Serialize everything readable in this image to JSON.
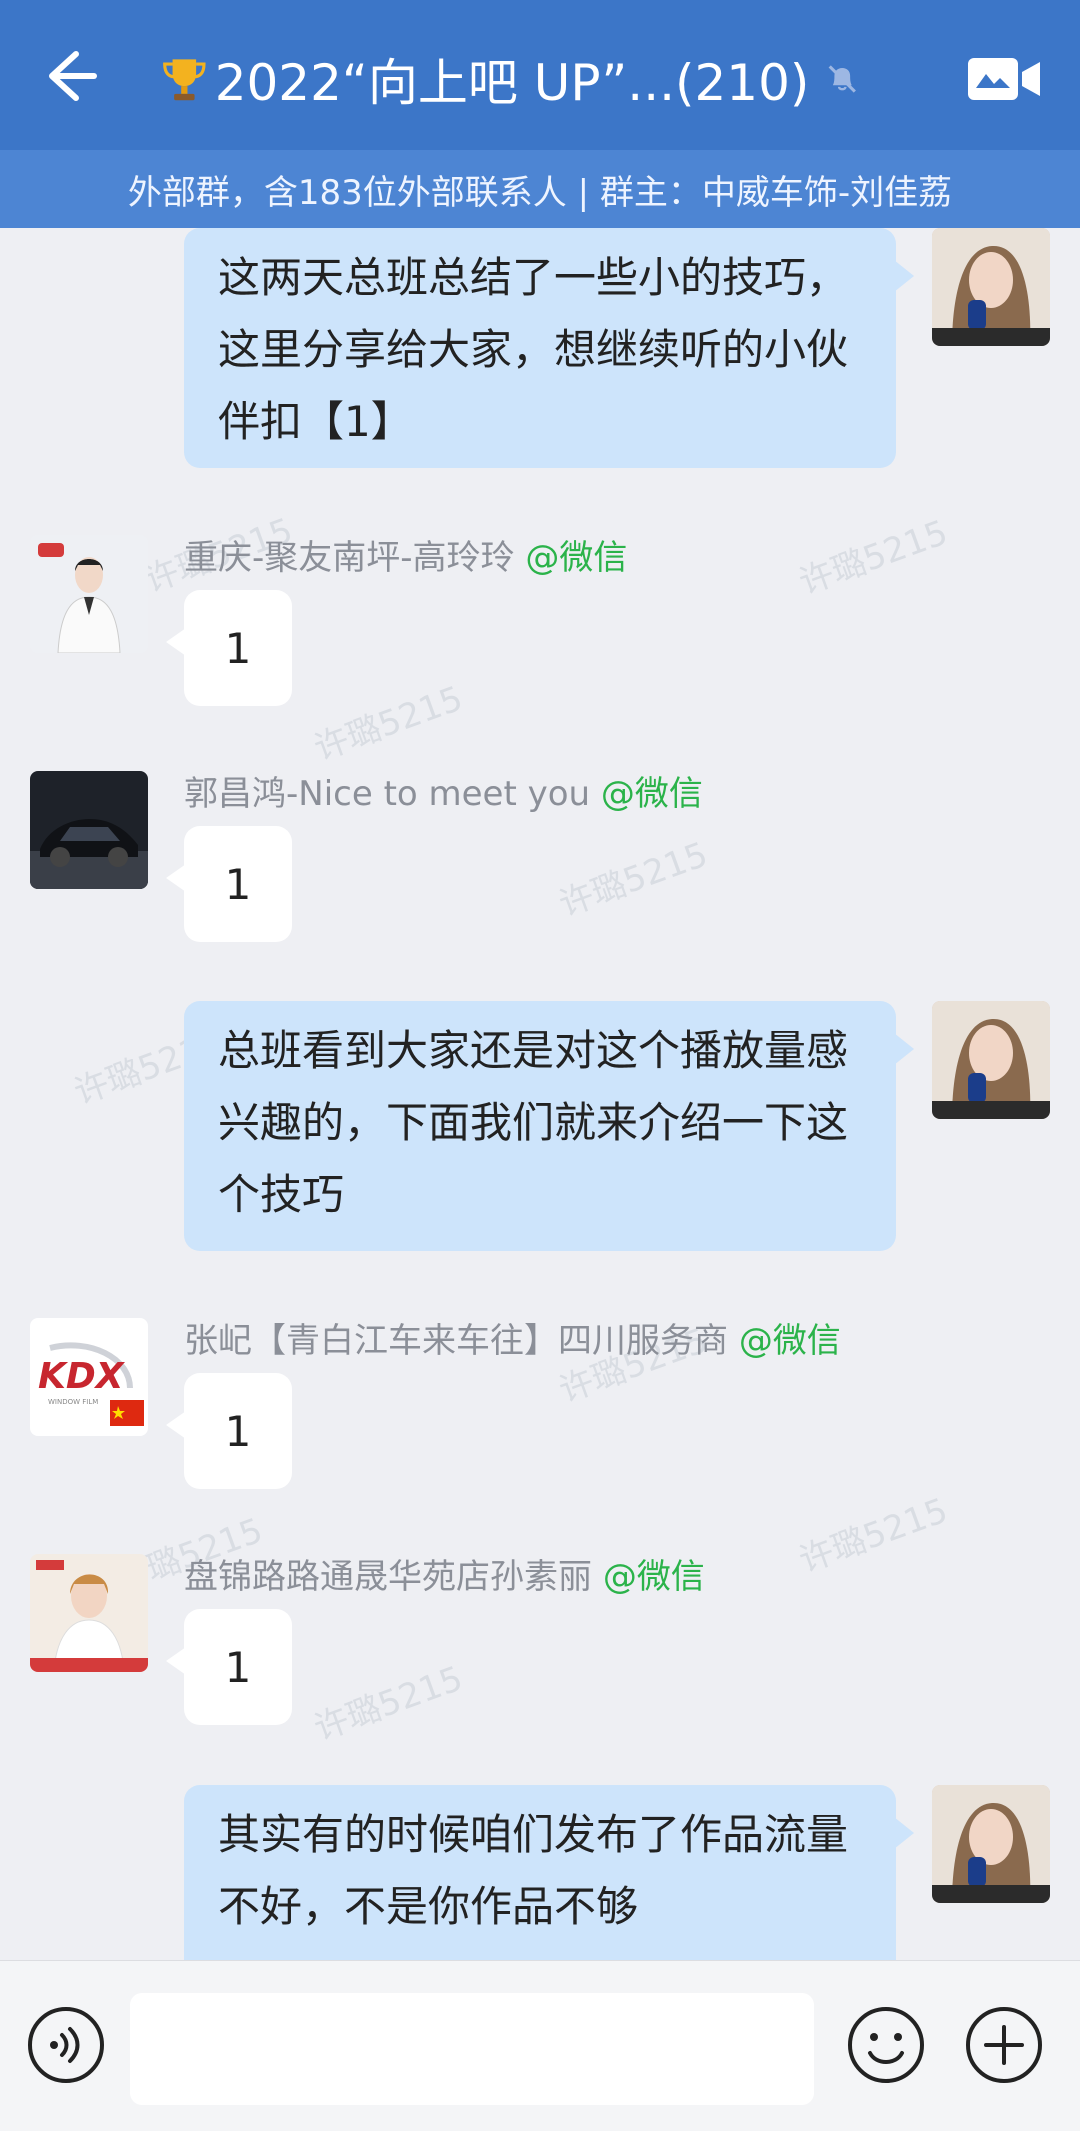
{
  "header": {
    "title": "2022“向上吧 UP”...(210)",
    "subtitle": "外部群，含183位外部联系人 | 群主：中威车饰-刘佳荔"
  },
  "watermark": "许璐5215",
  "messages": [
    {
      "type": "self",
      "text": "这两天总班总结了一些小的技巧，这里分享给大家，想继续听的小伙伴扣【1】"
    },
    {
      "type": "other",
      "sender": "重庆-聚友南坪-高玲玲",
      "tag": "@微信",
      "text": "1"
    },
    {
      "type": "other",
      "sender": "郭昌鸿-Nice to meet you",
      "tag": "@微信",
      "text": "1"
    },
    {
      "type": "self",
      "text": "总班看到大家还是对这个播放量感兴趣的，下面我们就来介绍一下这个技巧"
    },
    {
      "type": "other",
      "sender": "张屺【青白江车来车往】四川服务商",
      "tag": "@微信",
      "text": "1"
    },
    {
      "type": "other",
      "sender": "盘锦路路通晟华苑店孙素丽",
      "tag": "@微信",
      "text": "1"
    },
    {
      "type": "self",
      "text": "其实有的时候咱们发布了作品流量不好，不是你作品不够"
    }
  ],
  "avatars": {
    "kdx_logo": "KDX",
    "kdx_sub": "WINDOW FILM"
  },
  "colors": {
    "header_bg": "#3c76c8",
    "subbar_bg": "#4d85d3",
    "self_bubble": "#cde4fb",
    "tag_green": "#2bb34a"
  }
}
